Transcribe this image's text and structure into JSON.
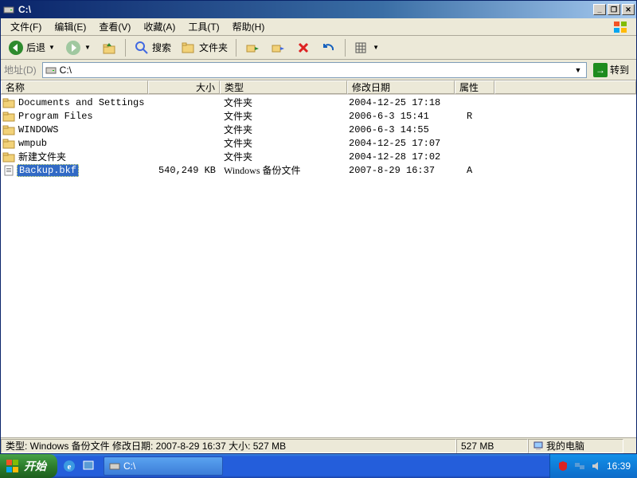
{
  "titlebar": {
    "title": "C:\\"
  },
  "menubar": {
    "file": "文件(F)",
    "edit": "编辑(E)",
    "view": "查看(V)",
    "favorites": "收藏(A)",
    "tools": "工具(T)",
    "help": "帮助(H)"
  },
  "toolbar": {
    "back": "后退",
    "search": "搜索",
    "folders": "文件夹"
  },
  "addressbar": {
    "label": "地址(D)",
    "value": "C:\\",
    "go": "转到"
  },
  "columns": {
    "name": "名称",
    "size": "大小",
    "type": "类型",
    "date": "修改日期",
    "attr": "属性"
  },
  "rows": [
    {
      "name": "Documents and Settings",
      "size": "",
      "type": "文件夹",
      "date": "2004-12-25 17:18",
      "attr": "",
      "kind": "folder",
      "selected": false
    },
    {
      "name": "Program Files",
      "size": "",
      "type": "文件夹",
      "date": "2006-6-3 15:41",
      "attr": "R",
      "kind": "folder",
      "selected": false
    },
    {
      "name": "WINDOWS",
      "size": "",
      "type": "文件夹",
      "date": "2006-6-3 14:55",
      "attr": "",
      "kind": "folder",
      "selected": false
    },
    {
      "name": "wmpub",
      "size": "",
      "type": "文件夹",
      "date": "2004-12-25 17:07",
      "attr": "",
      "kind": "folder",
      "selected": false
    },
    {
      "name": "新建文件夹",
      "size": "",
      "type": "文件夹",
      "date": "2004-12-28 17:02",
      "attr": "",
      "kind": "folder",
      "selected": false
    },
    {
      "name": "Backup.bkf",
      "size": "540,249 KB",
      "type": "Windows 备份文件",
      "date": "2007-8-29 16:37",
      "attr": "A",
      "kind": "file",
      "selected": true
    }
  ],
  "statusbar": {
    "info": "类型: Windows 备份文件 修改日期: 2007-8-29 16:37 大小: 527 MB",
    "size": "527 MB",
    "location": "我的电脑"
  },
  "taskbar": {
    "start": "开始",
    "task1": "C:\\",
    "clock": "16:39"
  }
}
